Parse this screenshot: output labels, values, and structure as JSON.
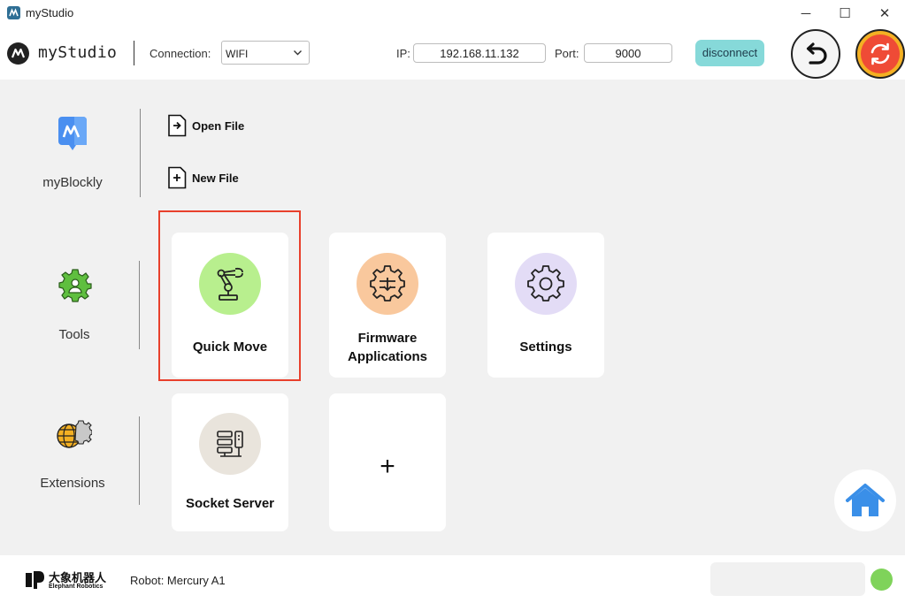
{
  "window": {
    "title": "myStudio",
    "minimize": "─",
    "maximize": "☐",
    "close": "✕"
  },
  "toolbar": {
    "brand": "myStudio",
    "connection_label": "Connection:",
    "connection_value": "WIFI",
    "ip_label": "IP:",
    "ip_value": "192.168.11.132",
    "port_label": "Port:",
    "port_value": "9000",
    "disconnect_label": "disconnect"
  },
  "sidebar": {
    "myblockly": {
      "label": "myBlockly",
      "icon": "myblockly-icon"
    },
    "tools": {
      "label": "Tools",
      "icon": "gear-person-icon"
    },
    "extensions": {
      "label": "Extensions",
      "icon": "globe-gear-icon"
    }
  },
  "blockly_actions": {
    "open_file": "Open File",
    "new_file": "New File"
  },
  "tools_cards": [
    {
      "label": "Quick Move",
      "icon": "robot-arm-icon",
      "color": "#b8ef8e"
    },
    {
      "label_line1": "Firmware",
      "label_line2": "Applications",
      "icon": "firmware-gear-icon",
      "color": "#f9c89d"
    },
    {
      "label": "Settings",
      "icon": "settings-gear-icon",
      "color": "#e3dcf6"
    }
  ],
  "extension_cards": [
    {
      "label": "Socket Server",
      "icon": "server-icon",
      "color": "#e9e4dc"
    },
    {
      "label": "+",
      "icon": "plus-icon"
    }
  ],
  "statusbar": {
    "company_cn": "大象机器人",
    "company_en": "Elephant Robotics",
    "robot_label": "Robot: Mercury A1",
    "status_color": "#7fd35a"
  }
}
